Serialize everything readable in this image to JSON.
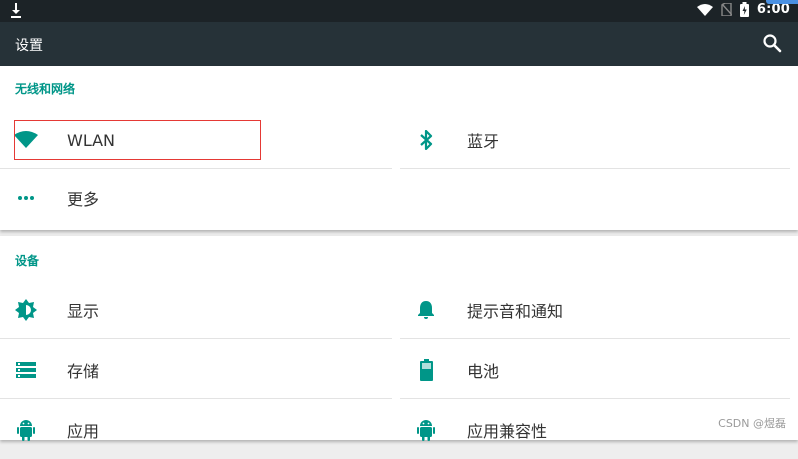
{
  "statusbar": {
    "time": "6:00"
  },
  "actionbar": {
    "title": "设置"
  },
  "sections": [
    {
      "title": "无线和网络",
      "tiles": [
        {
          "label": "WLAN",
          "icon": "wifi-icon"
        },
        {
          "label": "蓝牙",
          "icon": "bluetooth-icon"
        },
        {
          "label": "更多",
          "icon": "more-dots-icon"
        }
      ]
    },
    {
      "title": "设备",
      "tiles": [
        {
          "label": "显示",
          "icon": "brightness-icon"
        },
        {
          "label": "提示音和通知",
          "icon": "bell-icon"
        },
        {
          "label": "存储",
          "icon": "storage-icon"
        },
        {
          "label": "电池",
          "icon": "battery-icon"
        },
        {
          "label": "应用",
          "icon": "android-icon"
        },
        {
          "label": "应用兼容性",
          "icon": "android-icon"
        }
      ]
    }
  ],
  "watermark": "CSDN @煜磊",
  "colors": {
    "accent": "#009688",
    "actionbar": "#263238",
    "statusbar": "#1c2327",
    "highlight": "#e53935"
  }
}
